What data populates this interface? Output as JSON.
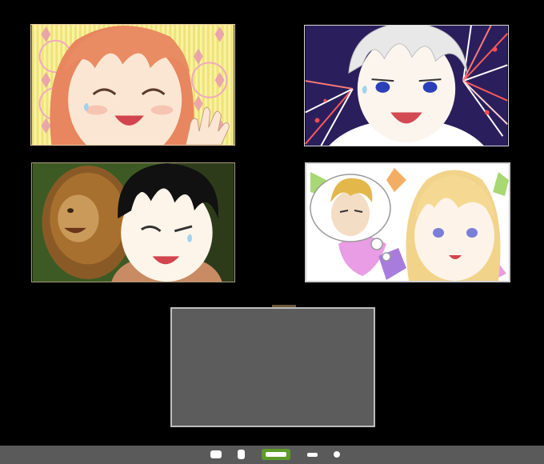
{
  "window": {
    "background": "#000000"
  },
  "participants": [
    {
      "id": "participant-1",
      "avatar": "red-haired-girl-waving",
      "background": "#f7f2a3"
    },
    {
      "id": "participant-2",
      "avatar": "white-haired-boy-fireworks",
      "background": "#2a1f5c"
    },
    {
      "id": "participant-3",
      "avatar": "black-haired-boy-with-lion",
      "background": "#3e5a24"
    },
    {
      "id": "participant-4",
      "avatar": "blonde-girl-with-thought-bubble",
      "background": "#ffffff"
    }
  ],
  "self_view": {
    "background": "#5c5c5c",
    "state": "camera-off"
  },
  "controls": {
    "background": "#5a5a5a",
    "accent": "#5e9b2a",
    "items": [
      {
        "id": "chat",
        "icon": "chat-icon"
      },
      {
        "id": "mic",
        "icon": "mic-icon"
      },
      {
        "id": "gallery",
        "icon": "gallery-view-icon",
        "active": true
      },
      {
        "id": "minimize",
        "icon": "minus-icon"
      },
      {
        "id": "more",
        "icon": "dot-icon"
      }
    ]
  }
}
